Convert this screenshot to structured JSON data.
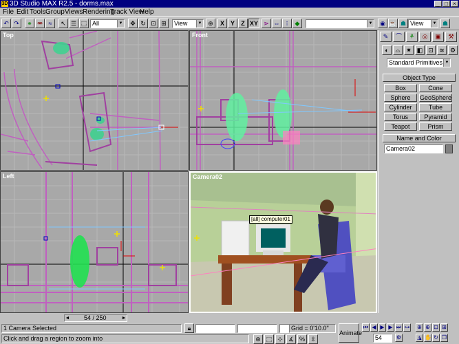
{
  "window": {
    "title": "3D Studio MAX R2.5 - dorms.max",
    "app_icon": "3dsmax-icon",
    "minimize_glyph": "_",
    "maximize_glyph": "□",
    "close_glyph": "×"
  },
  "menu": [
    "File",
    "Edit",
    "Tools",
    "Group",
    "Views",
    "Rendering",
    "Track View",
    "Help"
  ],
  "toolbar": {
    "selection_filter": "All",
    "reference_coord": "View",
    "axis_x": "X",
    "axis_y": "Y",
    "axis_z": "Z",
    "axis_xy": "XY",
    "named_selection": "",
    "render_type": "View"
  },
  "viewports": {
    "top": {
      "label": "Top"
    },
    "front": {
      "label": "Front"
    },
    "left": {
      "label": "Left"
    },
    "camera": {
      "label": "Camera02",
      "tooltip": "[all] computer01"
    }
  },
  "command_panel": {
    "category": "Standard Primitives",
    "object_type_title": "Object Type",
    "buttons": [
      "Box",
      "Cone",
      "Sphere",
      "GeoSphere",
      "Cylinder",
      "Tube",
      "Torus",
      "Pyramid",
      "Teapot",
      "Prism"
    ],
    "name_color_title": "Name and Color",
    "name_value": "Camera02",
    "swatch_color": "#808080"
  },
  "time": {
    "frame_display": "54 / 250",
    "current_frame": "54"
  },
  "status": {
    "selection": "1 Camera Selected",
    "prompt": "Click and drag a region to zoom into",
    "grid": "Grid = 0'10.0\"",
    "animate_label": "Animate"
  },
  "colors": {
    "titlebar": "#000080",
    "viewport_bg": "#a8a8a8",
    "active_border": "#ffffff"
  }
}
